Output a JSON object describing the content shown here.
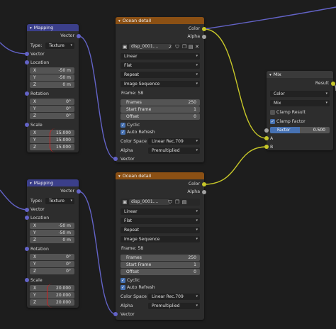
{
  "mapping_nodes": [
    {
      "title": "Mapping",
      "output_vector": "Vector",
      "type_label": "Type:",
      "type_value": "Texture",
      "input_vector": "Vector",
      "location_label": "Location",
      "location": [
        {
          "axis": "X",
          "value": "-50 m"
        },
        {
          "axis": "Y",
          "value": "-50 m"
        },
        {
          "axis": "Z",
          "value": "0 m"
        }
      ],
      "rotation_label": "Rotation",
      "rotation": [
        {
          "axis": "X",
          "value": "0°"
        },
        {
          "axis": "Y",
          "value": "0°"
        },
        {
          "axis": "Z",
          "value": "0°"
        }
      ],
      "scale_label": "Scale",
      "scale": [
        {
          "axis": "X",
          "value": "15.000"
        },
        {
          "axis": "Y",
          "value": "15.000"
        },
        {
          "axis": "Z",
          "value": "15.000"
        }
      ]
    },
    {
      "title": "Mapping",
      "output_vector": "Vector",
      "type_label": "Type:",
      "type_value": "Texture",
      "input_vector": "Vector",
      "location_label": "Location",
      "location": [
        {
          "axis": "X",
          "value": "-50 m"
        },
        {
          "axis": "Y",
          "value": "-50 m"
        },
        {
          "axis": "Z",
          "value": "0 m"
        }
      ],
      "rotation_label": "Rotation",
      "rotation": [
        {
          "axis": "X",
          "value": "0°"
        },
        {
          "axis": "Y",
          "value": "0°"
        },
        {
          "axis": "Z",
          "value": "0°"
        }
      ],
      "scale_label": "Scale",
      "scale": [
        {
          "axis": "X",
          "value": "20.000"
        },
        {
          "axis": "Y",
          "value": "20.000"
        },
        {
          "axis": "Z",
          "value": "20.000"
        }
      ]
    }
  ],
  "ocean_nodes": [
    {
      "title": "Ocean detail",
      "out_color": "Color",
      "out_alpha": "Alpha",
      "image_name": "disp_0001....",
      "users": "2",
      "interpolation": "Linear",
      "projection": "Flat",
      "extension": "Repeat",
      "source": "Image Sequence",
      "frame_label": "Frame: 58",
      "frames_label": "Frames",
      "frames_value": "250",
      "start_label": "Start Frame",
      "start_value": "1",
      "offset_label": "Offset",
      "offset_value": "0",
      "cyclic": "Cyclic",
      "auto_refresh": "Auto Refresh",
      "colorspace_label": "Color Space",
      "colorspace_value": "Linear Rec.709",
      "alpha_label": "Alpha",
      "alpha_value": "Premultiplied",
      "in_vector": "Vector"
    },
    {
      "title": "Ocean detail",
      "out_color": "Color",
      "out_alpha": "Alpha",
      "image_name": "disp_0001....",
      "users": "",
      "interpolation": "Linear",
      "projection": "Flat",
      "extension": "Repeat",
      "source": "Image Sequence",
      "frame_label": "Frame: 58",
      "frames_label": "Frames",
      "frames_value": "250",
      "start_label": "Start Frame",
      "start_value": "1",
      "offset_label": "Offset",
      "offset_value": "0",
      "cyclic": "Cyclic",
      "auto_refresh": "Auto Refresh",
      "colorspace_label": "Color Space",
      "colorspace_value": "Linear Rec.709",
      "alpha_label": "Alpha",
      "alpha_value": "Premultiplied",
      "in_vector": "Vector"
    }
  ],
  "mix_node": {
    "title": "Mix",
    "out_result": "Result",
    "data_type": "Color",
    "blend_mode": "Mix",
    "clamp_result": "Clamp Result",
    "clamp_factor": "Clamp Factor",
    "factor_label": "Factor",
    "factor_value": "0.500",
    "factor_fraction": 0.5,
    "in_a": "A",
    "in_b": "B"
  },
  "colors": {
    "background": "#1d1d1d",
    "node_body": "#2d2d2d",
    "mapping_header": "#3b3f8a",
    "ocean_header": "#8b5014",
    "vector_socket": "#6363c7",
    "color_socket": "#c7c729",
    "annotation_red": "#d21e1e",
    "checkbox_blue": "#4772b3"
  }
}
